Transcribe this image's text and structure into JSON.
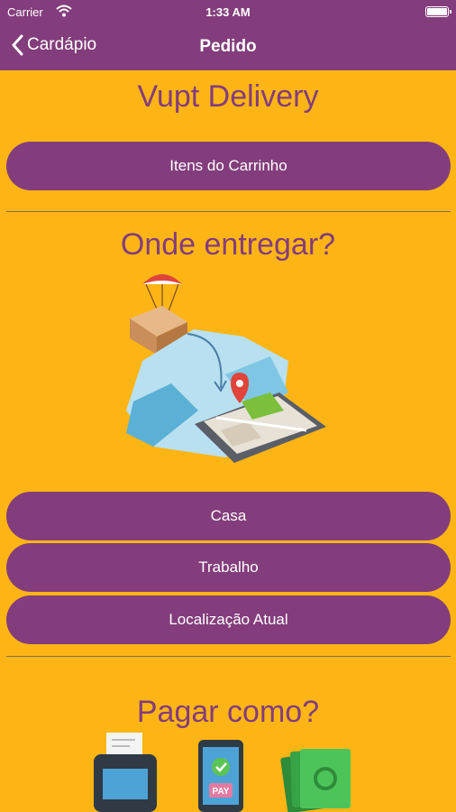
{
  "status_bar": {
    "carrier": "Carrier",
    "time": "1:33 AM"
  },
  "nav": {
    "back_label": "Cardápio",
    "title": "Pedido"
  },
  "brand": {
    "title": "Vupt Delivery"
  },
  "cart": {
    "button_label": "Itens do Carrinho"
  },
  "delivery": {
    "heading": "Onde entregar?",
    "options": [
      "Casa",
      "Trabalho",
      "Localização Atual"
    ]
  },
  "payment": {
    "heading": "Pagar como?",
    "pay_badge": "PAY"
  },
  "colors": {
    "primary": "#833D7C",
    "background": "#FDB515",
    "text_on_primary": "#FFFFFF"
  },
  "icons": [
    "wifi-icon",
    "battery-icon",
    "chevron-left-icon",
    "delivery-map-illustration",
    "card-machine-icon",
    "mobile-pay-icon",
    "cash-icon"
  ]
}
